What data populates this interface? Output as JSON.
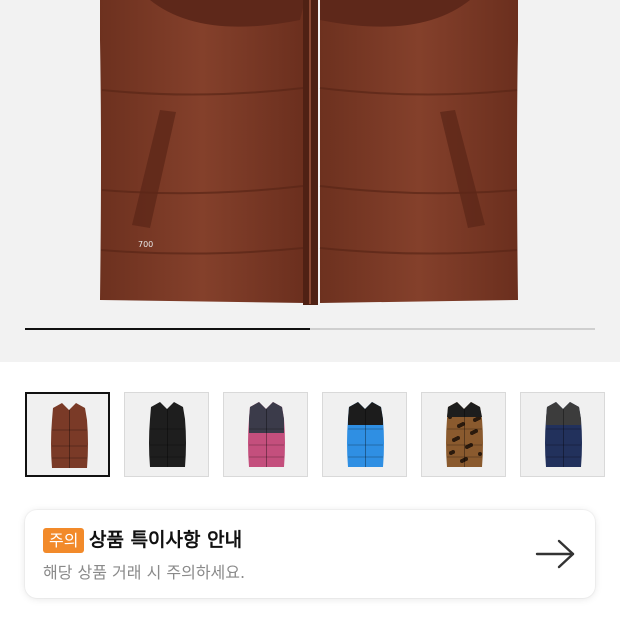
{
  "product": {
    "gallery": {
      "progress": 0.5,
      "main_image": "brown-down-vest-image",
      "main_badge_text": "700",
      "thumbnails": [
        {
          "name": "thumb-brown-vest",
          "color": "#7a3a27",
          "selected": true
        },
        {
          "name": "thumb-black-vest",
          "color": "#1e1e1e",
          "selected": false
        },
        {
          "name": "thumb-pink-vest",
          "color": "#c44f7d",
          "selected": false
        },
        {
          "name": "thumb-blue-vest",
          "color": "#2f8fe3",
          "selected": false
        },
        {
          "name": "thumb-leopard-vest",
          "color": "#8a5a2e",
          "selected": false
        },
        {
          "name": "thumb-navy-vest",
          "color": "#22315c",
          "selected": false
        }
      ]
    },
    "notice": {
      "badge": "주의",
      "title": "상품 특이사항 안내",
      "subtitle": "해당 상품 거래 시 주의하세요.",
      "arrow_icon": "arrow-right-icon"
    }
  },
  "colors": {
    "accent_orange": "#f28a2a",
    "vest_brown": "#7a3a27"
  }
}
